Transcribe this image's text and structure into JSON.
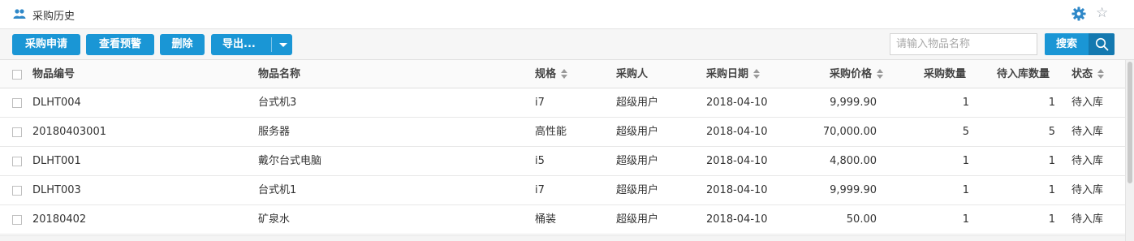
{
  "window": {
    "title": "采购历史"
  },
  "toolbar": {
    "apply_label": "采购申请",
    "alert_label": "查看预警",
    "delete_label": "删除",
    "export_label": "导出..."
  },
  "search": {
    "placeholder": "请输入物品名称",
    "value": "",
    "button_label": "搜索"
  },
  "table": {
    "columns": [
      "物品编号",
      "物品名称",
      "规格",
      "采购人",
      "采购日期",
      "采购价格",
      "采购数量",
      "待入库数量",
      "状态"
    ],
    "rows": [
      [
        "DLHT004",
        "台式机3",
        "i7",
        "超级用户",
        "2018-04-10",
        "9,999.90",
        "1",
        "1",
        "待入库"
      ],
      [
        "20180403001",
        "服务器",
        "高性能",
        "超级用户",
        "2018-04-10",
        "70,000.00",
        "5",
        "5",
        "待入库"
      ],
      [
        "DLHT001",
        "戴尔台式电脑",
        "i5",
        "超级用户",
        "2018-04-10",
        "4,800.00",
        "1",
        "1",
        "待入库"
      ],
      [
        "DLHT003",
        "台式机1",
        "i7",
        "超级用户",
        "2018-04-10",
        "9,999.90",
        "1",
        "1",
        "待入库"
      ],
      [
        "20180402",
        "矿泉水",
        "桶装",
        "超级用户",
        "2018-04-10",
        "50.00",
        "1",
        "1",
        "待入库"
      ]
    ]
  },
  "icons": {
    "title": "people-icon",
    "settings": "gear-icon",
    "favorite": "star-icon",
    "search": "search-icon",
    "dropdown": "caret-down-icon",
    "sort": "sort-icon"
  },
  "colors": {
    "accent": "#1a96d5",
    "accent_dark": "#1479b0",
    "icon_blue": "#2f88c8"
  }
}
